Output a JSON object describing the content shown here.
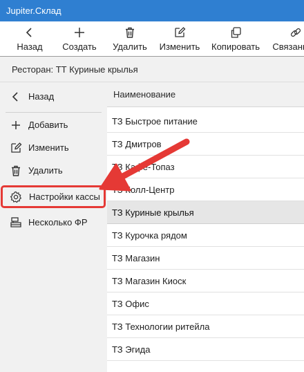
{
  "app": {
    "title": "Jupiter.Склад"
  },
  "toolbar": {
    "items": [
      {
        "label": "Назад",
        "icon": "chevron-left-icon"
      },
      {
        "label": "Создать",
        "icon": "plus-icon"
      },
      {
        "label": "Удалить",
        "icon": "trash-icon"
      },
      {
        "label": "Изменить",
        "icon": "edit-icon"
      },
      {
        "label": "Копировать",
        "icon": "copy-icon"
      },
      {
        "label": "Связанные",
        "icon": "link-icon"
      }
    ]
  },
  "breadcrumb": {
    "text": "Ресторан: ТТ Куриные крылья"
  },
  "sidebar": {
    "back_label": "Назад",
    "items": [
      {
        "label": "Добавить",
        "icon": "plus-icon"
      },
      {
        "label": "Изменить",
        "icon": "edit-icon"
      },
      {
        "label": "Удалить",
        "icon": "trash-icon"
      },
      {
        "label": "Настройки кассы",
        "icon": "gear-icon",
        "highlighted": true
      },
      {
        "label": "Несколько ФР",
        "icon": "cash-register-icon"
      }
    ]
  },
  "table": {
    "column": "Наименование",
    "rows": [
      "ТЗ Быстрое питание",
      "ТЗ Дмитров",
      "ТЗ Кафе-Топаз",
      "ТЗ Колл-Центр",
      "ТЗ Куриные крылья",
      "ТЗ Курочка рядом",
      "ТЗ Магазин",
      "ТЗ Магазин Киоск",
      "ТЗ Офис",
      "ТЗ Технологии ритейла",
      "ТЗ Эгида"
    ],
    "selected_row": "ТЗ Куриные крылья"
  },
  "annotation": {
    "color": "#e53935"
  }
}
